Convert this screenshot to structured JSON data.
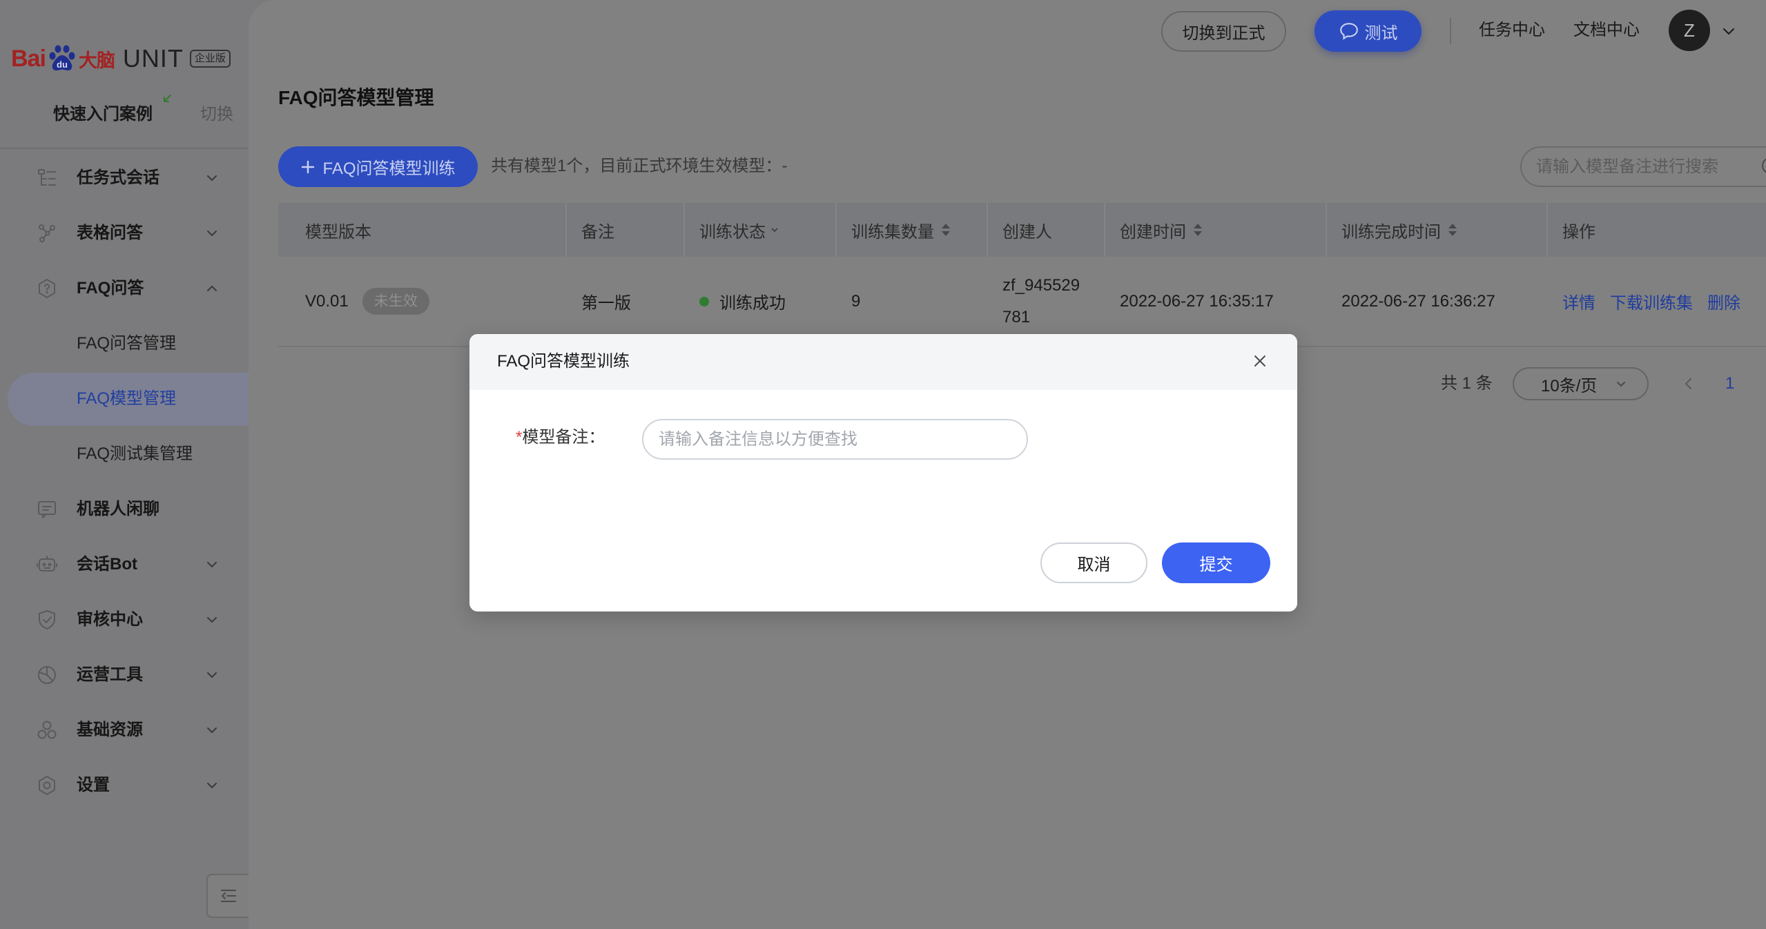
{
  "logo": {
    "brand_left": "Bai",
    "paw_text": "du",
    "brand_cn": "大脑",
    "product": "UNIT",
    "edition": "企业版"
  },
  "sidebar": {
    "quick_start": "快速入门案例",
    "switch": "切换",
    "items": [
      {
        "label": "任务式会话",
        "icon": "flow-icon",
        "expandable": true,
        "expanded": false
      },
      {
        "label": "表格问答",
        "icon": "nodes-icon",
        "expandable": true,
        "expanded": false
      },
      {
        "label": "FAQ问答",
        "icon": "faq-hexagon-icon",
        "expandable": true,
        "expanded": true,
        "children": [
          {
            "label": "FAQ问答管理",
            "active": false
          },
          {
            "label": "FAQ模型管理",
            "active": true
          },
          {
            "label": "FAQ测试集管理",
            "active": false
          }
        ]
      },
      {
        "label": "机器人闲聊",
        "icon": "chat-box-icon",
        "expandable": false
      },
      {
        "label": "会话Bot",
        "icon": "robot-icon",
        "expandable": true,
        "expanded": false
      },
      {
        "label": "审核中心",
        "icon": "shield-icon",
        "expandable": true,
        "expanded": false
      },
      {
        "label": "运营工具",
        "icon": "pie-chart-icon",
        "expandable": true,
        "expanded": false
      },
      {
        "label": "基础资源",
        "icon": "resources-icon",
        "expandable": true,
        "expanded": false
      },
      {
        "label": "设置",
        "icon": "settings-icon",
        "expandable": true,
        "expanded": false
      }
    ]
  },
  "header": {
    "switch_env": "切换到正式",
    "test": "测试",
    "links": [
      "任务中心",
      "文档中心"
    ],
    "avatar": "Z"
  },
  "page": {
    "title": "FAQ问答模型管理"
  },
  "toolbar": {
    "train_button": "FAQ问答模型训练",
    "summary": "共有模型1个，目前正式环境生效模型：-",
    "search_placeholder": "请输入模型备注进行搜索"
  },
  "table": {
    "columns": [
      {
        "label": "模型版本"
      },
      {
        "label": "备注"
      },
      {
        "label": "训练状态",
        "filterable": true
      },
      {
        "label": "训练集数量",
        "sortable": true
      },
      {
        "label": "创建人"
      },
      {
        "label": "创建时间",
        "sortable": true
      },
      {
        "label": "训练完成时间",
        "sortable": true
      },
      {
        "label": "操作"
      }
    ],
    "rows": [
      {
        "version": "V0.01",
        "tag": "未生效",
        "note": "第一版",
        "status": "训练成功",
        "train_count": "9",
        "creator": "zf_945529781",
        "created": "2022-06-27 16:35:17",
        "finished": "2022-06-27 16:36:27",
        "actions": [
          "详情",
          "下载训练集",
          "删除"
        ]
      }
    ]
  },
  "pagination": {
    "total": "共 1 条",
    "page_size": "10条/页",
    "current": "1"
  },
  "dialog": {
    "title": "FAQ问答模型训练",
    "required_mark": "*",
    "label": "模型备注：",
    "placeholder": "请输入备注信息以方便查找",
    "cancel": "取消",
    "submit": "提交"
  },
  "colors": {
    "primary": "#3d63f2",
    "primary_masked": "#2d4cbf",
    "link_masked": "#1f3c9e",
    "success": "#2f7d32",
    "required": "#e23c3c",
    "mask_gray": "#818181"
  }
}
